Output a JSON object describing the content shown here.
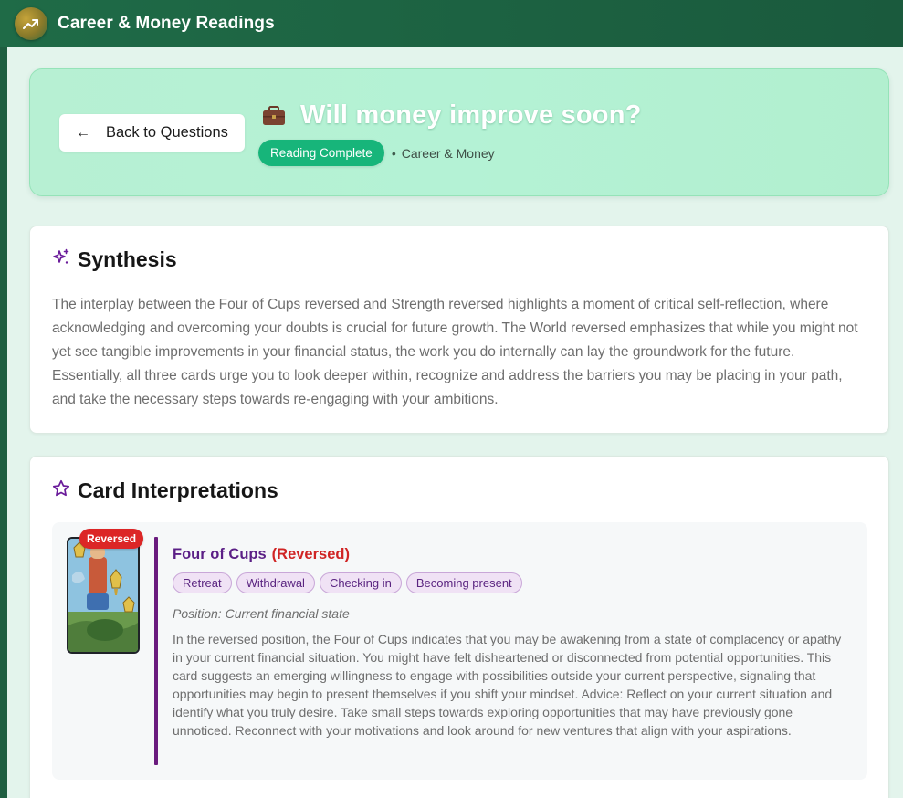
{
  "app": {
    "title": "Career & Money Readings",
    "logo_icon": "trending-up-icon"
  },
  "header": {
    "back_label": "Back to Questions",
    "question_icon": "briefcase-icon",
    "question": "Will money improve soon?",
    "status": "Reading Complete",
    "separator": "•",
    "category": "Career & Money"
  },
  "synthesis": {
    "icon": "sparkles-icon",
    "title": "Synthesis",
    "text": "The interplay between the Four of Cups reversed and Strength reversed highlights a moment of critical self-reflection, where acknowledging and overcoming your doubts is crucial for future growth. The World reversed emphasizes that while you might not yet see tangible improvements in your financial status, the work you do internally can lay the groundwork for the future. Essentially, all three cards urge you to look deeper within, recognize and address the barriers you may be placing in your path, and take the necessary steps towards re-engaging with your ambitions."
  },
  "interpretations": {
    "icon": "star-icon",
    "title": "Card Interpretations",
    "cards": [
      {
        "badge": "Reversed",
        "name": "Four of Cups",
        "orientation": "(Reversed)",
        "tags": [
          "Retreat",
          "Withdrawal",
          "Checking in",
          "Becoming present"
        ],
        "position": "Position: Current financial state",
        "meaning": "In the reversed position, the Four of Cups indicates that you may be awakening from a state of complacency or apathy in your current financial situation. You might have felt disheartened or disconnected from potential opportunities. This card suggests an emerging willingness to engage with possibilities outside your current perspective, signaling that opportunities may begin to present themselves if you shift your mindset. Advice: Reflect on your current situation and identify what you truly desire. Take small steps towards exploring opportunities that may have previously gone unnoticed. Reconnect with your motivations and look around for new ventures that align with your aspirations."
      }
    ]
  },
  "colors": {
    "topbar": "#1f6b47",
    "hero_bg": "#b7f0d3",
    "status_badge": "#17b57a",
    "accent_purple": "#6a1b7e",
    "reversed_red": "#dc2626"
  }
}
